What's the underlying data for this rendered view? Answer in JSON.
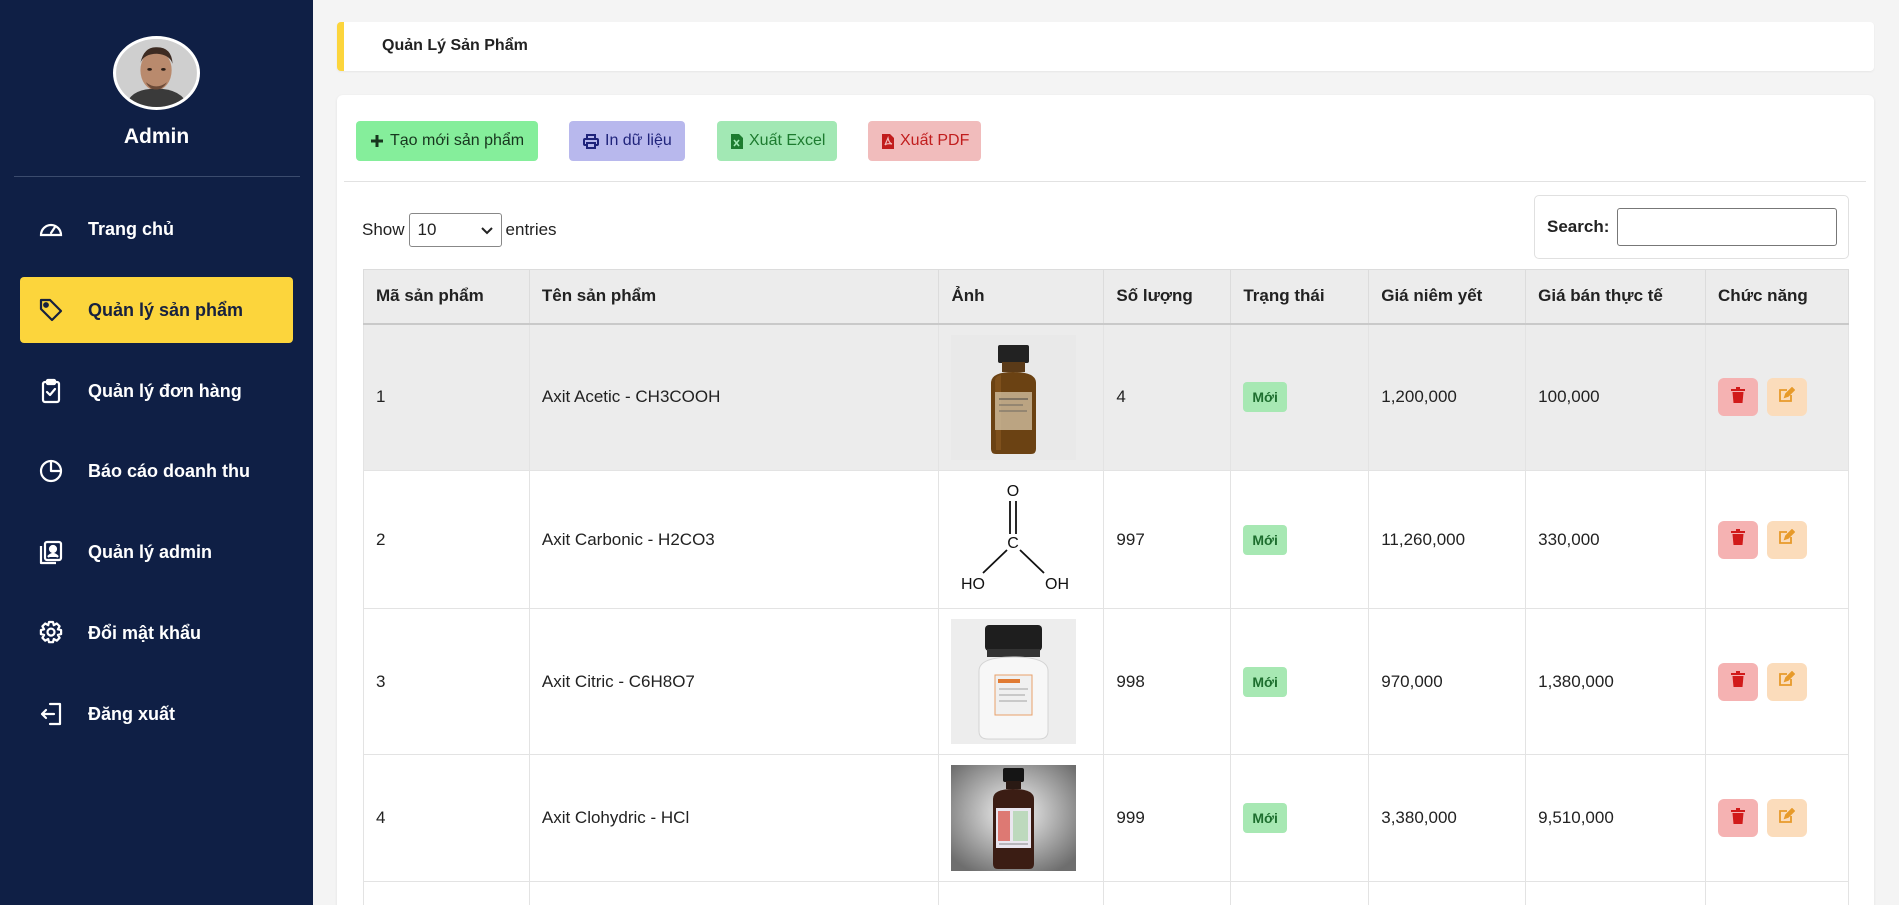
{
  "sidebar": {
    "admin_name": "Admin",
    "items": [
      {
        "label": "Trang chủ",
        "icon": "dashboard-icon",
        "active": false
      },
      {
        "label": "Quản lý sản phẩm",
        "icon": "tag-icon",
        "active": true
      },
      {
        "label": "Quản lý đơn hàng",
        "icon": "clipboard-check-icon",
        "active": false
      },
      {
        "label": "Báo cáo doanh thu",
        "icon": "pie-chart-icon",
        "active": false
      },
      {
        "label": "Quản lý admin",
        "icon": "user-list-icon",
        "active": false
      },
      {
        "label": "Đổi mật khẩu",
        "icon": "gear-icon",
        "active": false
      },
      {
        "label": "Đăng xuất",
        "icon": "logout-icon",
        "active": false
      }
    ],
    "active_color": "#fcd53c",
    "background_color": "#0f1f45"
  },
  "breadcrumb": {
    "title": "Quản Lý Sản Phẩm"
  },
  "toolbar": {
    "create_label": "Tạo mới sản phẩm",
    "print_label": "In dữ liệu",
    "excel_label": "Xuất Excel",
    "pdf_label": "Xuất PDF"
  },
  "table_controls": {
    "show_label": "Show",
    "entries_value": "10",
    "entries_label": "entries",
    "search_label": "Search:",
    "search_value": ""
  },
  "table": {
    "headers": [
      "Mã sản phẩm",
      "Tên sản phẩm",
      "Ảnh",
      "Số lượng",
      "Trạng thái",
      "Giá niêm yết",
      "Giá bán thực tế",
      "Chức năng"
    ],
    "rows": [
      {
        "id": "1",
        "name": "Axit Acetic - CH3COOH",
        "image": "brown-bottle-image",
        "quantity": "4",
        "status": "Mới",
        "list_price": "1,200,000",
        "sale_price": "100,000"
      },
      {
        "id": "2",
        "name": "Axit Carbonic - H2CO3",
        "image": "carbonic-acid-structure-image",
        "quantity": "997",
        "status": "Mới",
        "list_price": "11,260,000",
        "sale_price": "330,000"
      },
      {
        "id": "3",
        "name": "Axit Citric - C6H8O7",
        "image": "white-jar-image",
        "quantity": "998",
        "status": "Mới",
        "list_price": "970,000",
        "sale_price": "1,380,000"
      },
      {
        "id": "4",
        "name": "Axit Clohydric - HCl",
        "image": "dark-bottle-image",
        "quantity": "999",
        "status": "Mới",
        "list_price": "3,380,000",
        "sale_price": "9,510,000"
      }
    ]
  },
  "structure_labels": {
    "o": "O",
    "c": "C",
    "ho": "HO",
    "oh": "OH"
  }
}
